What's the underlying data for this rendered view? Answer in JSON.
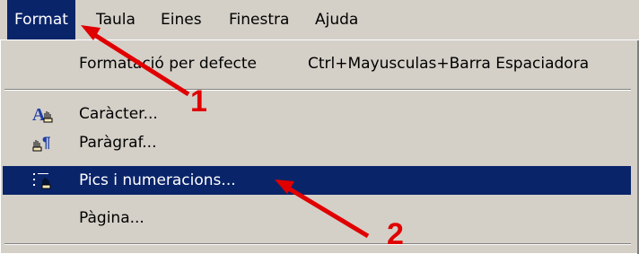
{
  "menubar": {
    "items": [
      {
        "label": "Format"
      },
      {
        "label": "Taula"
      },
      {
        "label": "Eines"
      },
      {
        "label": "Finestra"
      },
      {
        "label": "Ajuda"
      }
    ]
  },
  "menu": {
    "items": [
      {
        "label": "Formatació per defecte",
        "shortcut": "Ctrl+Mayusculas+Barra Espaciadora"
      },
      {
        "label": "Caràcter...",
        "icon": "character-icon"
      },
      {
        "label": "Paràgraf...",
        "icon": "paragraph-icon"
      },
      {
        "label": "Pics i numeracions...",
        "icon": "bullets-numbering-icon",
        "highlighted": true
      },
      {
        "label": "Pàgina..."
      }
    ]
  },
  "annotations": {
    "marker1": "1",
    "marker2": "2",
    "arrow_color": "#e00000"
  },
  "colors": {
    "menu_bg": "#d4d0c8",
    "highlight": "#0a246a"
  }
}
